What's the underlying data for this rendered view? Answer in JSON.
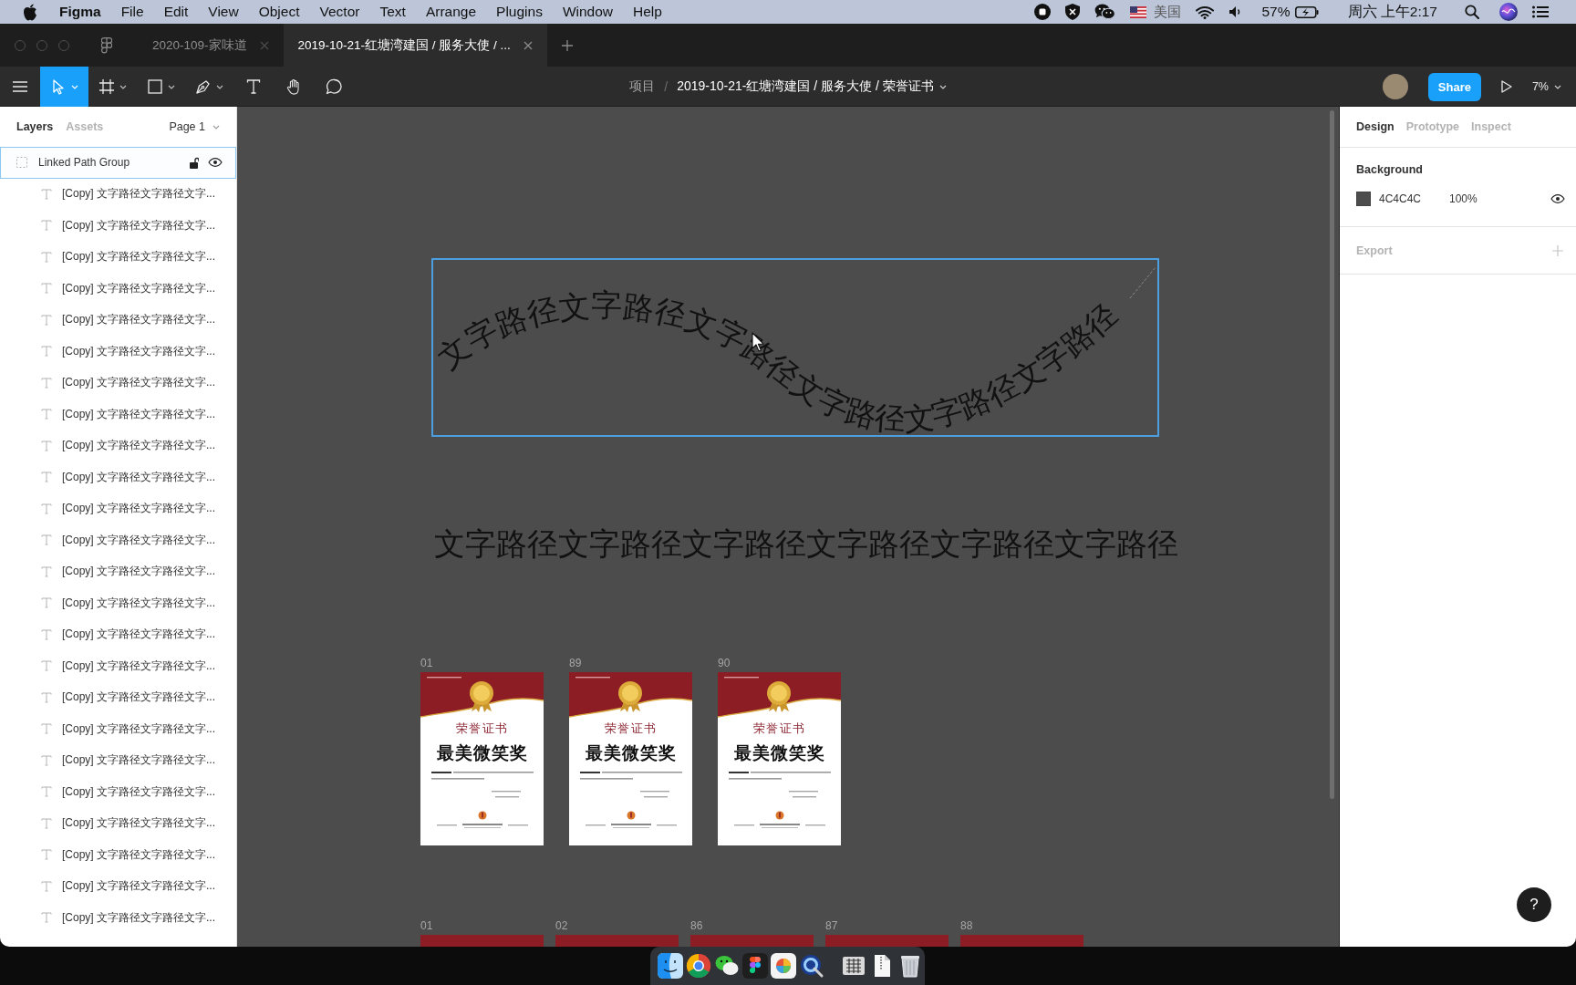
{
  "menu_bar": {
    "app_name": "Figma",
    "menus": [
      "File",
      "Edit",
      "View",
      "Object",
      "Vector",
      "Text",
      "Arrange",
      "Plugins",
      "Window",
      "Help"
    ],
    "input_source": "美国",
    "battery_percent": "57%",
    "clock": "周六 上午2:17"
  },
  "tabs": [
    {
      "label": "2020-109-家味道",
      "selected": false
    },
    {
      "label": "2019-10-21-红塘湾建国 / 服务大使 / ...",
      "selected": true
    }
  ],
  "toolbar": {
    "tools": [
      {
        "kind": "move",
        "selected": true,
        "caret": true
      },
      {
        "kind": "frame",
        "selected": false,
        "caret": true
      },
      {
        "kind": "rectangle",
        "selected": false,
        "caret": true
      },
      {
        "kind": "pen",
        "selected": false,
        "caret": true
      },
      {
        "kind": "text",
        "selected": false,
        "caret": false
      },
      {
        "kind": "hand",
        "selected": false,
        "caret": false
      },
      {
        "kind": "comment",
        "selected": false,
        "caret": false
      }
    ],
    "breadcrumb": {
      "project": "项目",
      "separator": "/",
      "file": "2019-10-21-红塘湾建国 / 服务大使 / 荣誉证书"
    },
    "share": "Share",
    "zoom": "7%"
  },
  "left_panel": {
    "tabs": [
      {
        "label": "Layers",
        "selected": true
      },
      {
        "label": "Assets",
        "selected": false
      }
    ],
    "page": "Page 1",
    "layers": [
      {
        "kind": "group",
        "name": "Linked Path Group",
        "selected": true,
        "children": [
          {
            "kind": "text",
            "name": "[Copy] 文字路径文字路径文字...",
            "selected": false
          },
          {
            "kind": "text",
            "name": "[Copy] 文字路径文字路径文字...",
            "selected": false
          },
          {
            "kind": "text",
            "name": "[Copy] 文字路径文字路径文字...",
            "selected": false
          },
          {
            "kind": "text",
            "name": "[Copy] 文字路径文字路径文字...",
            "selected": false
          },
          {
            "kind": "text",
            "name": "[Copy] 文字路径文字路径文字...",
            "selected": false
          },
          {
            "kind": "text",
            "name": "[Copy] 文字路径文字路径文字...",
            "selected": false
          },
          {
            "kind": "text",
            "name": "[Copy] 文字路径文字路径文字...",
            "selected": false
          },
          {
            "kind": "text",
            "name": "[Copy] 文字路径文字路径文字...",
            "selected": false
          },
          {
            "kind": "text",
            "name": "[Copy] 文字路径文字路径文字...",
            "selected": false
          },
          {
            "kind": "text",
            "name": "[Copy] 文字路径文字路径文字...",
            "selected": false
          },
          {
            "kind": "text",
            "name": "[Copy] 文字路径文字路径文字...",
            "selected": false
          },
          {
            "kind": "text",
            "name": "[Copy] 文字路径文字路径文字...",
            "selected": false
          },
          {
            "kind": "text",
            "name": "[Copy] 文字路径文字路径文字...",
            "selected": false
          },
          {
            "kind": "text",
            "name": "[Copy] 文字路径文字路径文字...",
            "selected": false
          },
          {
            "kind": "text",
            "name": "[Copy] 文字路径文字路径文字...",
            "selected": false
          },
          {
            "kind": "text",
            "name": "[Copy] 文字路径文字路径文字...",
            "selected": false
          },
          {
            "kind": "text",
            "name": "[Copy] 文字路径文字路径文字...",
            "selected": false
          },
          {
            "kind": "text",
            "name": "[Copy] 文字路径文字路径文字...",
            "selected": false
          },
          {
            "kind": "text",
            "name": "[Copy] 文字路径文字路径文字...",
            "selected": false
          },
          {
            "kind": "text",
            "name": "[Copy] 文字路径文字路径文字...",
            "selected": false
          },
          {
            "kind": "text",
            "name": "[Copy] 文字路径文字路径文字...",
            "selected": false
          },
          {
            "kind": "text",
            "name": "[Copy] 文字路径文字路径文字...",
            "selected": false
          },
          {
            "kind": "text",
            "name": "[Copy] 文字路径文字路径文字...",
            "selected": false
          },
          {
            "kind": "text",
            "name": "[Copy] 文字路径文字路径文字...",
            "selected": false
          }
        ]
      }
    ]
  },
  "canvas": {
    "path_text": "文字路径文字路径文字路径文字路径文字路径文字路径",
    "plain_text": "文字路径文字路径文字路径文字路径文字路径文字路径",
    "frame_rows": [
      {
        "frames": [
          {
            "label": "01",
            "title": "荣誉证书",
            "award": "最美微笑奖"
          },
          {
            "label": "89",
            "title": "荣誉证书",
            "award": "最美微笑奖"
          },
          {
            "label": "90",
            "title": "荣誉证书",
            "award": "最美微笑奖"
          }
        ]
      },
      {
        "frames": [
          {
            "label": "01"
          },
          {
            "label": "02"
          },
          {
            "label": "86"
          },
          {
            "label": "87"
          },
          {
            "label": "88"
          }
        ]
      }
    ]
  },
  "right_panel": {
    "tabs": [
      {
        "label": "Design",
        "selected": true
      },
      {
        "label": "Prototype",
        "selected": false
      },
      {
        "label": "Inspect",
        "selected": false
      }
    ],
    "background": {
      "heading": "Background",
      "hex": "4C4C4C",
      "opacity": "100%"
    },
    "export": {
      "heading": "Export"
    }
  },
  "help": "?"
}
